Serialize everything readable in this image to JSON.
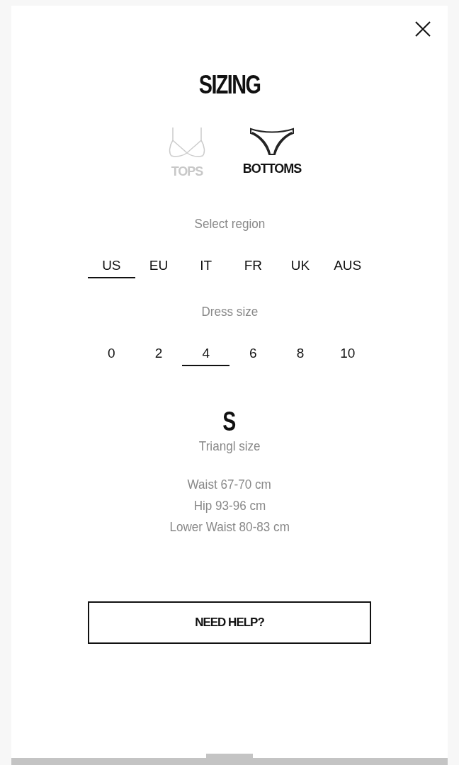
{
  "title": "SIZING",
  "categories": [
    {
      "label": "TOPS",
      "kind": "top",
      "selected": false
    },
    {
      "label": "BOTTOMS",
      "kind": "bottom",
      "selected": true
    }
  ],
  "region_label": "Select region",
  "regions": [
    {
      "label": "US",
      "selected": true
    },
    {
      "label": "EU",
      "selected": false
    },
    {
      "label": "IT",
      "selected": false
    },
    {
      "label": "FR",
      "selected": false
    },
    {
      "label": "UK",
      "selected": false
    },
    {
      "label": "AUS",
      "selected": false
    }
  ],
  "dress_size_label": "Dress size",
  "dress_sizes": [
    {
      "label": "0",
      "selected": false
    },
    {
      "label": "2",
      "selected": false
    },
    {
      "label": "4",
      "selected": true
    },
    {
      "label": "6",
      "selected": false
    },
    {
      "label": "8",
      "selected": false
    },
    {
      "label": "10",
      "selected": false
    }
  ],
  "result": {
    "size": "S",
    "caption": "Triangl size"
  },
  "measurements": [
    "Waist 67-70 cm",
    "Hip 93-96 cm",
    "Lower Waist 80-83 cm"
  ],
  "help_button": "NEED HELP?"
}
